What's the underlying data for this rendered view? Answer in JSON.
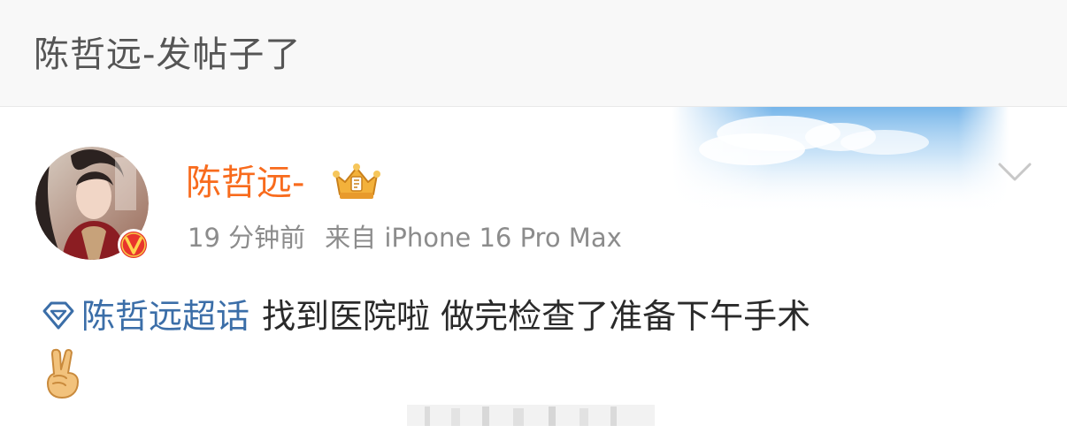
{
  "header": {
    "title": "陈哲远-发帖子了"
  },
  "post": {
    "username": "陈哲远-",
    "time": "19 分钟前",
    "source": "来自 iPhone 16 Pro Max",
    "topic": "陈哲远超话",
    "text": "找到医院啦 做完检查了准备下午手术",
    "emoji": "victory-hand"
  },
  "colors": {
    "username": "#f86b1d",
    "topic": "#3b6ea8",
    "meta": "#8c8c8c",
    "badge": "#e8352c"
  }
}
